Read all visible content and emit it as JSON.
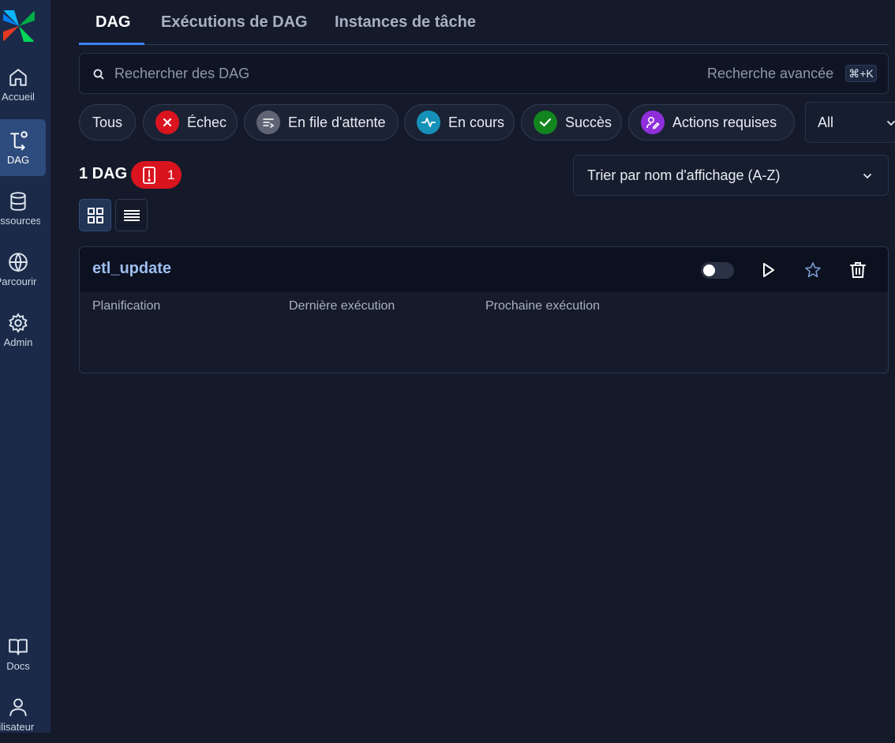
{
  "sidebar": {
    "items": [
      {
        "label": "Accueil",
        "icon": "home-icon"
      },
      {
        "label": "DAG",
        "icon": "dag-icon"
      },
      {
        "label": "essources",
        "icon": "database-icon"
      },
      {
        "label": "Parcourir",
        "icon": "globe-icon"
      },
      {
        "label": "Admin",
        "icon": "gear-icon"
      },
      {
        "label": "Docs",
        "icon": "book-icon"
      },
      {
        "label": "tilisateur",
        "icon": "user-icon"
      }
    ]
  },
  "tabs": [
    {
      "label": "DAG",
      "active": true
    },
    {
      "label": "Exécutions de DAG",
      "active": false
    },
    {
      "label": "Instances de tâche",
      "active": false
    }
  ],
  "search": {
    "placeholder": "Rechercher des DAG",
    "advanced_label": "Recherche avancée",
    "shortcut": "⌘+K"
  },
  "filters": {
    "chips": [
      {
        "label": "Tous",
        "icon": null,
        "color": null
      },
      {
        "label": "Échec",
        "icon": "x-icon",
        "color": "#d9141f"
      },
      {
        "label": "En file d'attente",
        "icon": "queue-icon",
        "color": "#5e6473"
      },
      {
        "label": "En cours",
        "icon": "activity-icon",
        "color": "#1591b8"
      },
      {
        "label": "Succès",
        "icon": "check-icon",
        "color": "#12851f"
      },
      {
        "label": "Actions requises",
        "icon": "user-action-icon",
        "color": "#8f2fdc"
      }
    ],
    "select_value": "All"
  },
  "summary": {
    "dag_count": "1 DAG",
    "error_count": "1"
  },
  "sort": {
    "value": "Trier par nom d'affichage (A-Z)"
  },
  "dags": [
    {
      "name": "etl_update",
      "enabled": false,
      "columns": [
        "Planification",
        "Dernière exécution",
        "Prochaine exécution"
      ]
    }
  ],
  "colors": {
    "accent": "#3b82f6",
    "sidebar": "#1b2a48",
    "background": "#141a2a",
    "error": "#d9141f"
  }
}
